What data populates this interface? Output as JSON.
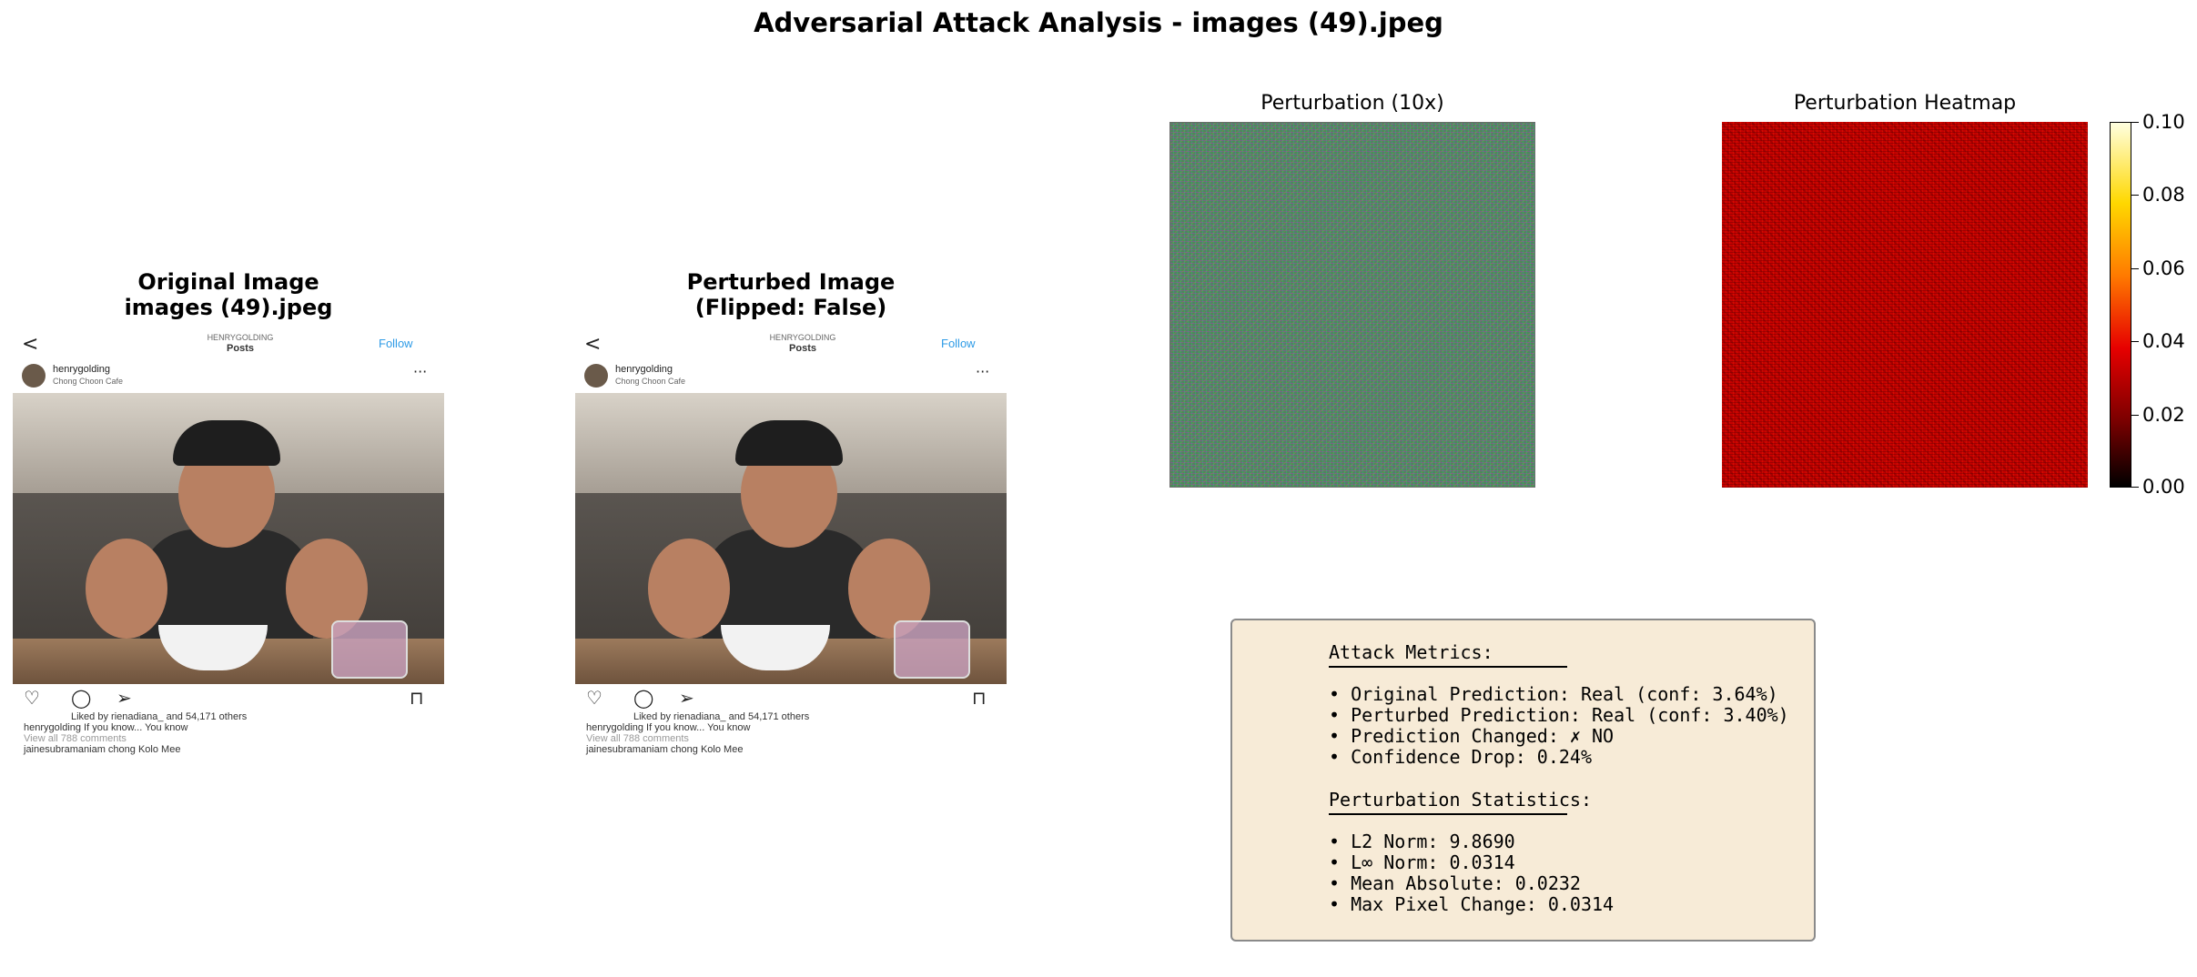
{
  "figure": {
    "title": "Adversarial Attack Analysis - images (49).jpeg"
  },
  "panels": {
    "original": {
      "title_line1": "Original Image",
      "title_line2": "images (49).jpeg",
      "post": {
        "header": "HENRYGOLDING",
        "header_sub": "Posts",
        "follow": "Follow",
        "username": "henrygolding",
        "location": "Chong Choon Cafe",
        "likes": "Liked by rienadiana_ and 54,171 others",
        "caption": "henrygolding If you know... You know",
        "comments": "View all 788 comments",
        "comment": "jainesubramaniam chong Kolo Mee"
      }
    },
    "perturbed": {
      "title_line1": "Perturbed Image",
      "title_line2": "(Flipped: False)",
      "post": {
        "header": "HENRYGOLDING",
        "header_sub": "Posts",
        "follow": "Follow",
        "username": "henrygolding",
        "location": "Chong Choon Cafe",
        "likes": "Liked by rienadiana_ and 54,171 others",
        "caption": "henrygolding If you know... You know",
        "comments": "View all 788 comments",
        "comment": "jainesubramaniam chong Kolo Mee"
      }
    },
    "perturbation": {
      "title": "Perturbation (10x)"
    },
    "heatmap": {
      "title": "Perturbation Heatmap",
      "colormap": "hot",
      "colorbar_ticks": [
        "0.00",
        "0.02",
        "0.04",
        "0.06",
        "0.08",
        "0.10"
      ]
    }
  },
  "metrics": {
    "attack_header": "Attack Metrics:",
    "attack_lines": [
      "• Original Prediction: Real (conf: 3.64%)",
      "• Perturbed Prediction: Real (conf: 3.40%)",
      "• Prediction Changed: ✗ NO",
      "• Confidence Drop: 0.24%"
    ],
    "stats_header": "Perturbation Statistics:",
    "stats_lines": [
      "• L2 Norm: 9.8690",
      "• L∞ Norm: 0.0314",
      "• Mean Absolute: 0.0232",
      "• Max Pixel Change: 0.0314"
    ],
    "background_color": "#f7ebd7"
  }
}
